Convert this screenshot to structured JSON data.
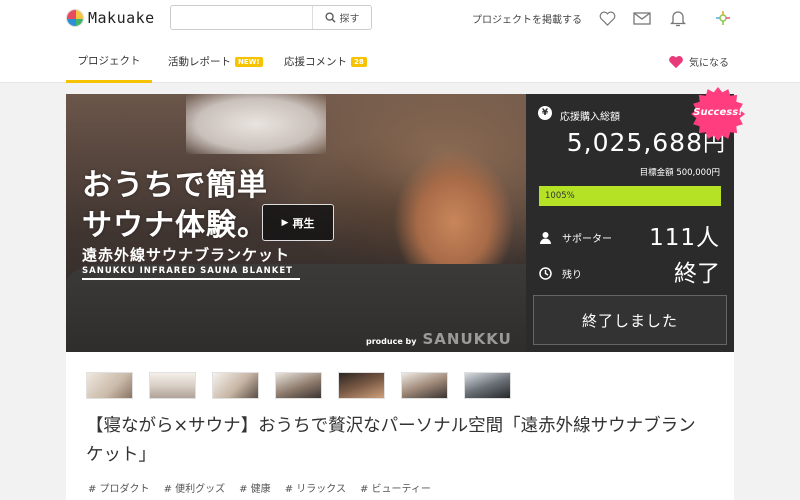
{
  "header": {
    "logo_text": "Makuake",
    "search_placeholder": "",
    "search_button": "探す",
    "post_project": "プロジェクトを掲載する",
    "icons": [
      "heart-icon",
      "mail-icon",
      "bell-icon",
      "user-avatar-icon"
    ]
  },
  "tabs": [
    {
      "label": "プロジェクト",
      "badge": null,
      "active": true
    },
    {
      "label": "活動レポート",
      "badge": "NEW!",
      "active": false
    },
    {
      "label": "応援コメント",
      "badge": "28",
      "active": false
    }
  ],
  "favorite_label": "気になる",
  "hero": {
    "headline_line1": "おうちで簡単",
    "headline_line2": "サウナ体験。",
    "product_jp": "遠赤外線サウナブランケット",
    "product_en": "SANUKKU INFRARED SAUNA BLANKET",
    "play_label": "再生",
    "produce_by": "produce by",
    "brand": "SANUKKU"
  },
  "stats": {
    "total_label": "応援購入総額",
    "total_amount": "5,025,688",
    "currency": "円",
    "goal": "目標金額 500,000円",
    "progress_text": "1005%",
    "progress_percent": 1005,
    "supporters_label": "サポーター",
    "supporters_value": "111人",
    "remaining_label": "残り",
    "remaining_value": "終了",
    "ended_button": "終了しました",
    "success_badge": "Success!"
  },
  "colors": {
    "accent": "#f7c300",
    "progress": "#b6e226",
    "panel": "#2b2b2b",
    "success": "#ff3d7f",
    "heart": "#e8397a"
  },
  "title": "【寝ながら×サウナ】おうちで贅沢なパーソナル空間「遠赤外線サウナブランケット」",
  "tags": [
    "# プロダクト",
    "# 便利グッズ",
    "# 健康",
    "# リラックス",
    "# ビューティー"
  ]
}
